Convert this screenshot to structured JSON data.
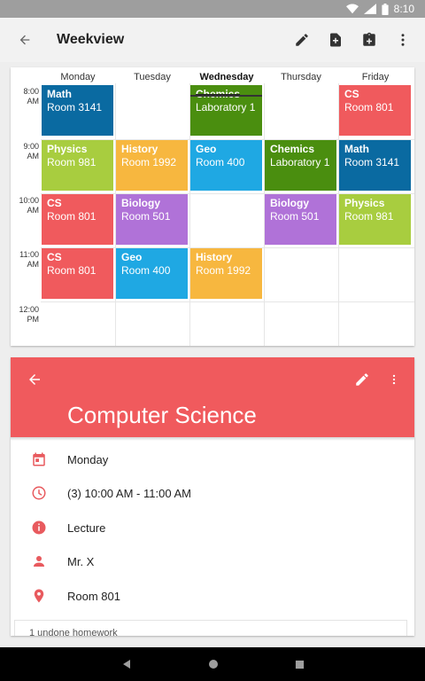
{
  "status_bar": {
    "time": "8:10",
    "network": "LTE"
  },
  "toolbar": {
    "title": "Weekview"
  },
  "week": {
    "days": [
      "Monday",
      "Tuesday",
      "Wednesday",
      "Thursday",
      "Friday"
    ],
    "times": [
      {
        "hour": "8:00",
        "ampm": "AM"
      },
      {
        "hour": "9:00",
        "ampm": "AM"
      },
      {
        "hour": "10:00",
        "ampm": "AM"
      },
      {
        "hour": "11:00",
        "ampm": "AM"
      },
      {
        "hour": "12:00",
        "ampm": "PM"
      }
    ],
    "lessons": {
      "mon8": {
        "subject": "Math",
        "room": "Room 3141",
        "color": "#0a6aa1"
      },
      "wed8": {
        "subject": "Chemics",
        "room": "Laboratory 1",
        "color": "#4a8e0f"
      },
      "fri8": {
        "subject": "CS",
        "room": "Room 801",
        "color": "#f05a5d"
      },
      "mon9": {
        "subject": "Physics",
        "room": "Room 981",
        "color": "#a8cd3f"
      },
      "tue9": {
        "subject": "History",
        "room": "Room 1992",
        "color": "#f7b73f"
      },
      "wed9": {
        "subject": "Geo",
        "room": "Room 400",
        "color": "#1fa8e3"
      },
      "thu9": {
        "subject": "Chemics",
        "room": "Laboratory 1",
        "color": "#4a8e0f"
      },
      "fri9": {
        "subject": "Math",
        "room": "Room 3141",
        "color": "#0a6aa1"
      },
      "mon10": {
        "subject": "CS",
        "room": "Room 801",
        "color": "#f05a5d"
      },
      "tue10": {
        "subject": "Biology",
        "room": "Room 501",
        "color": "#b072d8"
      },
      "thu10": {
        "subject": "Biology",
        "room": "Room 501",
        "color": "#b072d8"
      },
      "fri10": {
        "subject": "Physics",
        "room": "Room 981",
        "color": "#a8cd3f"
      },
      "mon11": {
        "subject": "CS",
        "room": "Room 801",
        "color": "#f05a5d"
      },
      "tue11": {
        "subject": "Geo",
        "room": "Room 400",
        "color": "#1fa8e3"
      },
      "wed11": {
        "subject": "History",
        "room": "Room 1992",
        "color": "#f7b73f"
      }
    }
  },
  "detail": {
    "title": "Computer Science",
    "header_color": "#f05a5d",
    "day": "Monday",
    "time": "(3) 10:00 AM - 11:00 AM",
    "type": "Lecture",
    "teacher": "Mr. X",
    "room": "Room 801",
    "homework": "1 undone homework"
  }
}
